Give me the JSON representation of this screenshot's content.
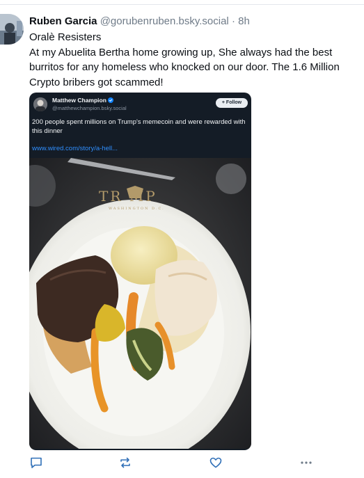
{
  "post": {
    "display_name": "Ruben Garcia",
    "handle": "@gorubenruben.bsky.social",
    "separator": "·",
    "time": "8h",
    "lines": [
      "Oralè Resisters",
      "At my Abuelita Bertha home growing up, She always had the best burritos for any homeless who knocked on our door. The 1.6 Million Crypto bribers got scammed!"
    ]
  },
  "embed": {
    "display_name": "Matthew Champion",
    "verified_icon": "verified-badge-icon",
    "handle": "@matthewchampion.bsky.social",
    "follow_label": "+ Follow",
    "text": "200 people spent millions on Trump's memecoin and were rewarded with this dinner",
    "link": "www.wired.com/story/a-hell...",
    "plate_brand": "TR  MP",
    "plate_sub": "WASHINGTON D.C."
  },
  "actions": {
    "reply_icon": "reply-icon",
    "repost_icon": "repost-icon",
    "like_icon": "heart-icon",
    "more_icon": "more-icon"
  },
  "colors": {
    "accent": "#1083fe",
    "muted": "#6f7b88",
    "embed_bg": "#141c26"
  }
}
